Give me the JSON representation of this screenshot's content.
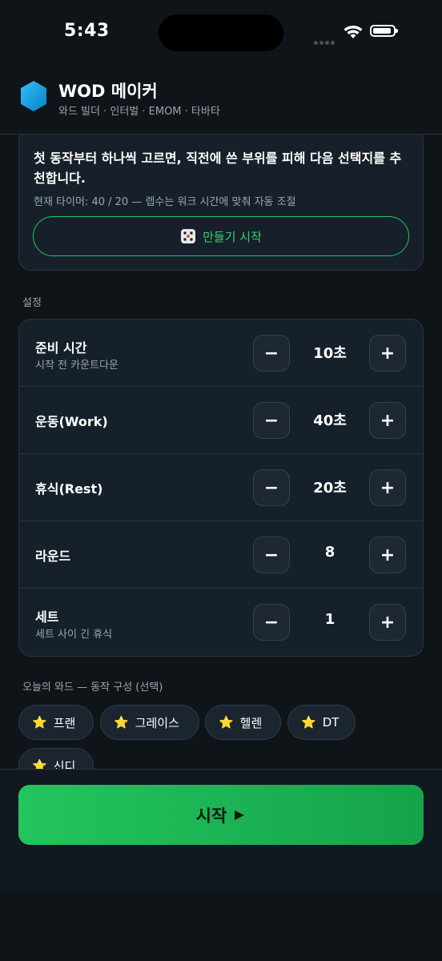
{
  "status": {
    "time": "5:43"
  },
  "header": {
    "title": "WOD 메이커",
    "subtitle": "와드 빌더 · 인터벌 · EMOM · 타바타",
    "logo_icon": "hexagon-logo-icon"
  },
  "builder": {
    "description": "첫 동작부터 하나씩 고르면, 직전에 쓴 부위를 피해 다음 선택지를 추천합니다.",
    "timer_note": "현재 타이머: 40 / 20 — 렙수는 워크 시간에 맞춰 자동 조절",
    "start_label": "만들기 시작",
    "start_icon": "dice-icon"
  },
  "settings": {
    "section_label": "설정",
    "rows": [
      {
        "label": "준비 시간",
        "sub": "시작 전 카운트다운",
        "value": "10초"
      },
      {
        "label": "운동(Work)",
        "sub": "",
        "value": "40초"
      },
      {
        "label": "휴식(Rest)",
        "sub": "",
        "value": "20초"
      },
      {
        "label": "라운드",
        "sub": "",
        "value": "8"
      },
      {
        "label": "세트",
        "sub": "세트 사이 긴 휴식",
        "value": "1"
      }
    ],
    "minus_glyph": "−",
    "plus_glyph": "+"
  },
  "wod": {
    "section_label": "오늘의 와드 — 동작 구성 (선택)",
    "chips": [
      "프랜",
      "그레이스",
      "헬렌",
      "DT",
      "신디"
    ],
    "chip_icon": "star-icon"
  },
  "footer": {
    "start_label": "시작",
    "start_icon": "play-icon"
  },
  "colors": {
    "accent": "#22c55e",
    "background": "#0f1419",
    "card": "#17202a"
  }
}
